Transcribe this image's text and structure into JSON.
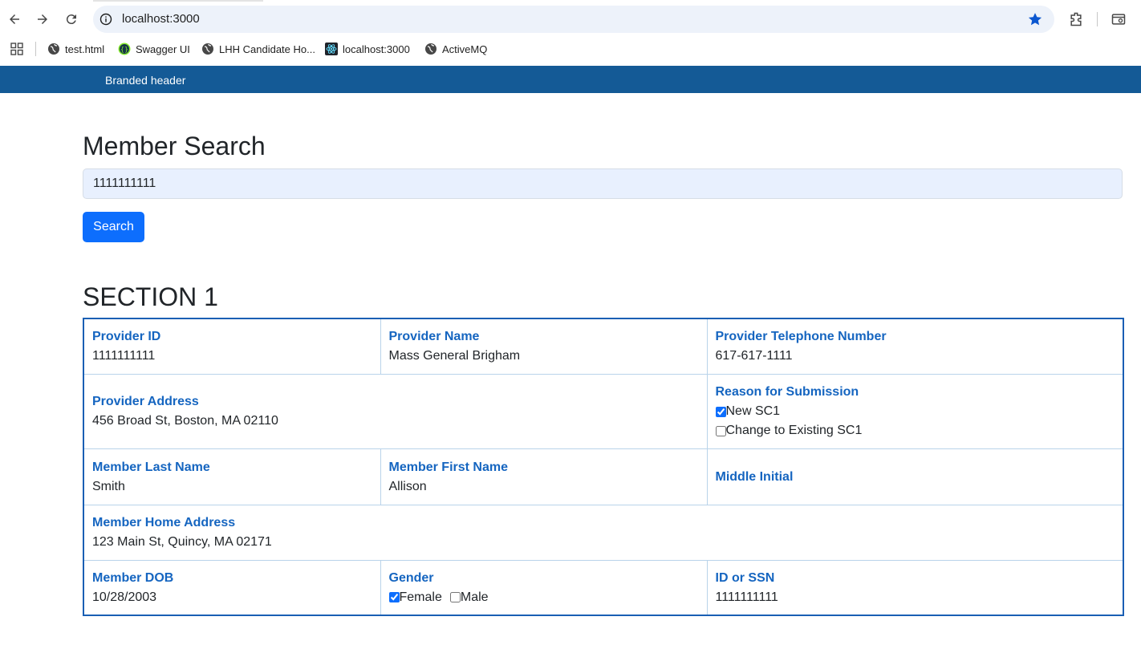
{
  "browser": {
    "url": "localhost:3000",
    "bookmarks": [
      {
        "label": "test.html",
        "icon": "globe-icon"
      },
      {
        "label": "Swagger UI",
        "icon": "swagger-icon"
      },
      {
        "label": "LHH Candidate Ho...",
        "icon": "globe-icon"
      },
      {
        "label": "localhost:3000",
        "icon": "react-icon"
      },
      {
        "label": "ActiveMQ",
        "icon": "globe-icon"
      }
    ]
  },
  "header": {
    "brand_text": "Branded header",
    "brand_color": "#145a96"
  },
  "search": {
    "title": "Member Search",
    "value": "1111111111",
    "button_label": "Search"
  },
  "section": {
    "title": "SECTION 1",
    "provider_id_label": "Provider ID",
    "provider_id_value": "1111111111",
    "provider_name_label": "Provider Name",
    "provider_name_value": "Mass General Brigham",
    "provider_phone_label": "Provider Telephone Number",
    "provider_phone_value": "617-617-1111",
    "provider_address_label": "Provider Address",
    "provider_address_value": "456 Broad St, Boston, MA 02110",
    "reason_label": "Reason for Submission",
    "reason_options": [
      {
        "label": "New SC1",
        "checked": true
      },
      {
        "label": "Change to Existing SC1",
        "checked": false
      }
    ],
    "member_last_label": "Member Last Name",
    "member_last_value": "Smith",
    "member_first_label": "Member First Name",
    "member_first_value": "Allison",
    "middle_initial_label": "Middle Initial",
    "home_address_label": "Member Home Address",
    "home_address_value": "123 Main St, Quincy, MA 02171",
    "dob_label": "Member DOB",
    "dob_value": "10/28/2003",
    "gender_label": "Gender",
    "gender_options": [
      {
        "label": "Female",
        "checked": true
      },
      {
        "label": "Male",
        "checked": false
      }
    ],
    "id_label": "ID or SSN",
    "id_value": "1111111111"
  },
  "colors": {
    "label": "#1565c0",
    "primary_button": "#0d6efd",
    "table_border": "#1a5fb4"
  }
}
